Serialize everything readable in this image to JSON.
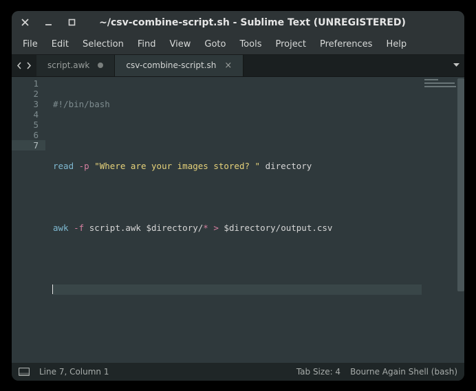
{
  "title": "~/csv-combine-script.sh - Sublime Text (UNREGISTERED)",
  "menus": [
    "File",
    "Edit",
    "Selection",
    "Find",
    "View",
    "Goto",
    "Tools",
    "Project",
    "Preferences",
    "Help"
  ],
  "tabs": [
    {
      "label": "script.awk",
      "dirty": true,
      "active": false
    },
    {
      "label": "csv-combine-script.sh",
      "dirty": false,
      "active": true
    }
  ],
  "gutter": [
    "1",
    "2",
    "3",
    "4",
    "5",
    "6",
    "7"
  ],
  "active_line_index": 6,
  "code": {
    "l1": {
      "shebang": "#!/bin/bash"
    },
    "l3": {
      "read": "read",
      "flag": "-p",
      "str": "\"Where are your images stored? \"",
      "arg": "directory"
    },
    "l5": {
      "awk": "awk",
      "flag": "-f",
      "script": "script.awk",
      "dir1": "$directory/",
      "glob": "*",
      "op": ">",
      "out": "$directory/output.csv"
    }
  },
  "status": {
    "linecol": "Line 7, Column 1",
    "tabsize": "Tab Size: 4",
    "syntax": "Bourne Again Shell (bash)"
  },
  "chart_data": {
    "type": "table",
    "title": "code lines",
    "rows": [
      "#!/bin/bash",
      "",
      "read -p \"Where are your images stored? \" directory",
      "",
      "awk -f script.awk $directory/* > $directory/output.csv",
      "",
      ""
    ]
  }
}
